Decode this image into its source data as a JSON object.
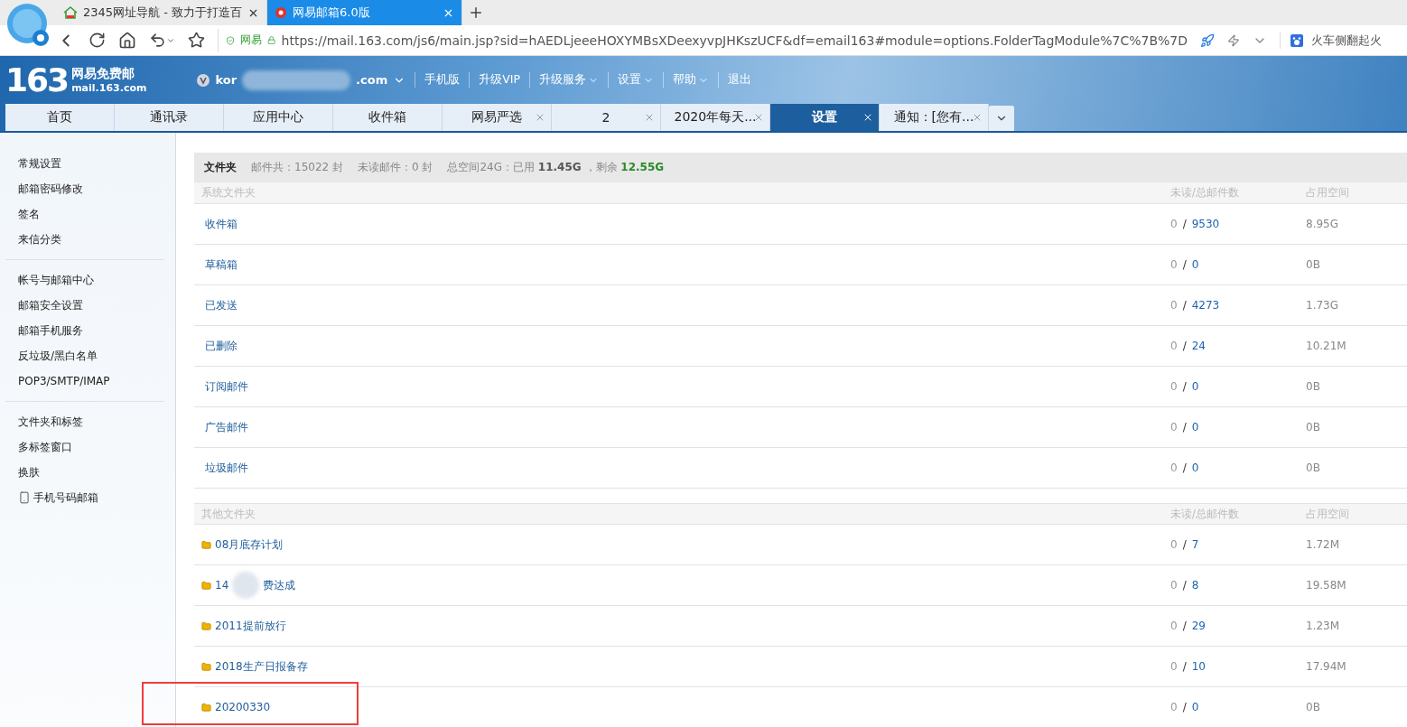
{
  "browser": {
    "tabs": [
      {
        "title": "2345网址导航 - 致力于打造百",
        "selected": false
      },
      {
        "title": "网易邮箱6.0版",
        "selected": true
      }
    ],
    "security_label": "网易",
    "url": "https://mail.163.com/js6/main.jsp?sid=hAEDLjeeeHOXYMBsXDeexyvpJHKszUCF&df=email163#module=options.FolderTagModule%7C%7B%7D",
    "search_hint": "火车侧翻起火"
  },
  "mail_header": {
    "logo_number": "163",
    "logo_title": "网易免费邮",
    "logo_domain": "mail.163.com",
    "user_start": "kor",
    "user_end": ".com",
    "links": [
      {
        "label": "手机版",
        "dropdown": false
      },
      {
        "label": "升级VIP",
        "dropdown": false
      },
      {
        "label": "升级服务",
        "dropdown": true
      },
      {
        "label": "设置",
        "dropdown": true
      },
      {
        "label": "帮助",
        "dropdown": true
      },
      {
        "label": "退出",
        "dropdown": false
      }
    ]
  },
  "mail_tabs": [
    {
      "label": "首页",
      "selected": false,
      "closable": false
    },
    {
      "label": "通讯录",
      "selected": false,
      "closable": false
    },
    {
      "label": "应用中心",
      "selected": false,
      "closable": false
    },
    {
      "label": "收件箱",
      "selected": false,
      "closable": false
    },
    {
      "label": "网易严选",
      "selected": false,
      "closable": true
    },
    {
      "label": "2",
      "selected": false,
      "closable": true
    },
    {
      "label": "2020年每天...",
      "selected": false,
      "closable": true
    },
    {
      "label": "设置",
      "selected": true,
      "closable": true
    },
    {
      "label": "通知：[您有...",
      "selected": false,
      "closable": true
    }
  ],
  "sidebar": {
    "groups": [
      {
        "items": [
          {
            "label": "常规设置",
            "kind": "text"
          },
          {
            "label": "邮箱密码修改",
            "kind": "text"
          },
          {
            "label": "签名",
            "kind": "text"
          },
          {
            "label": "来信分类",
            "kind": "text"
          }
        ]
      },
      {
        "items": [
          {
            "label": "帐号与邮箱中心",
            "kind": "text"
          },
          {
            "label": "邮箱安全设置",
            "kind": "text"
          },
          {
            "label": "邮箱手机服务",
            "kind": "text"
          },
          {
            "label": "反垃圾/黑白名单",
            "kind": "text"
          },
          {
            "label": "POP3/SMTP/IMAP",
            "kind": "text"
          }
        ]
      },
      {
        "items": [
          {
            "label": "文件夹和标签",
            "kind": "text"
          },
          {
            "label": "多标签窗口",
            "kind": "text"
          },
          {
            "label": "换肤",
            "kind": "text"
          },
          {
            "label": "手机号码邮箱",
            "kind": "phone"
          }
        ]
      }
    ]
  },
  "summary": {
    "title": "文件夹",
    "total": "邮件共：15022 封",
    "unread": "未读邮件：0 封",
    "space_label": "总空间24G：已用",
    "used": "11.45G",
    "remain_label": "，剩余",
    "remain": "12.55G"
  },
  "sections": [
    {
      "title": "系统文件夹",
      "count_header": "未读/总邮件数",
      "size_header": "占用空间",
      "folders": [
        {
          "kind": "system",
          "name_parts": [
            "收件箱"
          ],
          "unread": "0",
          "separator": "/",
          "total": "9530",
          "size": "8.95G",
          "annotated": false
        },
        {
          "kind": "system",
          "name_parts": [
            "草稿箱"
          ],
          "unread": "0",
          "separator": "/",
          "total": "0",
          "size": "0B",
          "annotated": false
        },
        {
          "kind": "system",
          "name_parts": [
            "已发送"
          ],
          "unread": "0",
          "separator": "/",
          "total": "4273",
          "size": "1.73G",
          "annotated": false
        },
        {
          "kind": "system",
          "name_parts": [
            "已删除"
          ],
          "unread": "0",
          "separator": "/",
          "total": "24",
          "size": "10.21M",
          "annotated": false
        },
        {
          "kind": "system",
          "name_parts": [
            "订阅邮件"
          ],
          "unread": "0",
          "separator": "/",
          "total": "0",
          "size": "0B",
          "annotated": false
        },
        {
          "kind": "system",
          "name_parts": [
            "广告邮件"
          ],
          "unread": "0",
          "separator": "/",
          "total": "0",
          "size": "0B",
          "annotated": false
        },
        {
          "kind": "system",
          "name_parts": [
            "垃圾邮件"
          ],
          "unread": "0",
          "separator": "/",
          "total": "0",
          "size": "0B",
          "annotated": false
        }
      ]
    },
    {
      "title": "其他文件夹",
      "count_header": "未读/总邮件数",
      "size_header": "占用空间",
      "folders": [
        {
          "kind": "custom",
          "name_parts": [
            "08月底存计划"
          ],
          "unread": "0",
          "separator": "/",
          "total": "7",
          "size": "1.72M",
          "annotated": false
        },
        {
          "kind": "custom",
          "name_parts": [
            "14",
            "费达成"
          ],
          "unread": "0",
          "separator": "/",
          "total": "8",
          "size": "19.58M",
          "annotated": false
        },
        {
          "kind": "custom",
          "name_parts": [
            "2011提前放行"
          ],
          "unread": "0",
          "separator": "/",
          "total": "29",
          "size": "1.23M",
          "annotated": false
        },
        {
          "kind": "custom",
          "name_parts": [
            "2018生产日报备存"
          ],
          "unread": "0",
          "separator": "/",
          "total": "10",
          "size": "17.94M",
          "annotated": false
        },
        {
          "kind": "custom",
          "name_parts": [
            "20200330"
          ],
          "unread": "0",
          "separator": "/",
          "total": "0",
          "size": "0B",
          "annotated": true
        }
      ]
    }
  ]
}
